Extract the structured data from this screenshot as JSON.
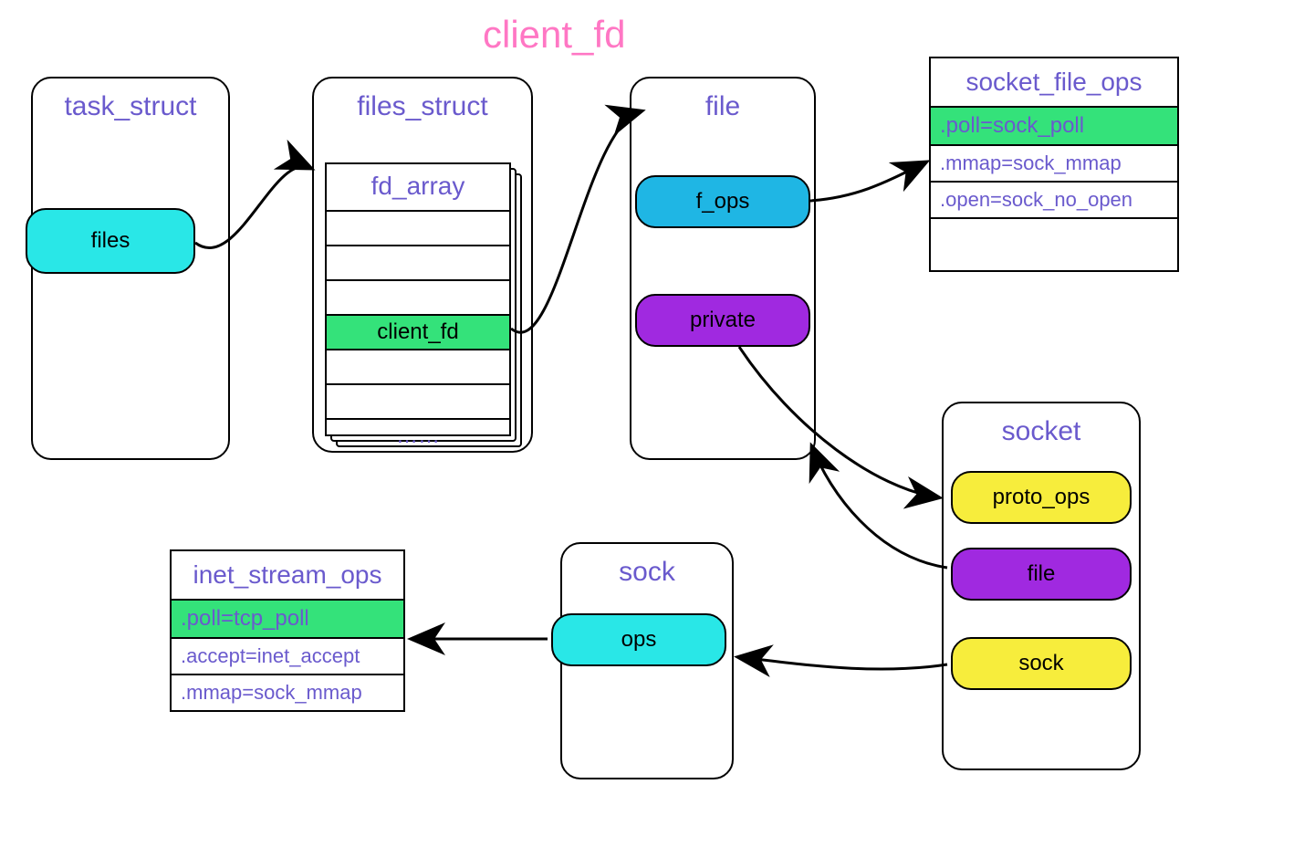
{
  "title": "client_fd",
  "task_struct": {
    "title": "task_struct",
    "field_files": "files"
  },
  "files_struct": {
    "title": "files_struct",
    "fd_array": {
      "title": "fd_array",
      "slots": [
        "",
        "",
        "",
        "client_fd",
        "",
        "",
        "……"
      ]
    }
  },
  "file": {
    "title": "file",
    "field_fops": "f_ops",
    "field_private": "private"
  },
  "socket_file_ops": {
    "title": "socket_file_ops",
    "rows": [
      {
        "text": ".poll=sock_poll",
        "highlight": true
      },
      {
        "text": ".mmap=sock_mmap",
        "highlight": false
      },
      {
        "text": ".open=sock_no_open",
        "highlight": false
      }
    ]
  },
  "socket": {
    "title": "socket",
    "field_proto_ops": "proto_ops",
    "field_file": "file",
    "field_sock": "sock"
  },
  "sock": {
    "title": "sock",
    "field_ops": "ops"
  },
  "inet_stream_ops": {
    "title": "inet_stream_ops",
    "rows": [
      {
        "text": ".poll=tcp_poll",
        "highlight": true
      },
      {
        "text": ".accept=inet_accept",
        "highlight": false
      },
      {
        "text": ".mmap=sock_mmap",
        "highlight": false
      }
    ]
  },
  "colors": {
    "title_pink": "#ff77c4",
    "label_purple": "#6a5acd",
    "cyan": "#29e7e7",
    "deep_cyan": "#1fb6e4",
    "green": "#34e27a",
    "purple": "#a029e0",
    "yellow": "#f7ed3c"
  }
}
